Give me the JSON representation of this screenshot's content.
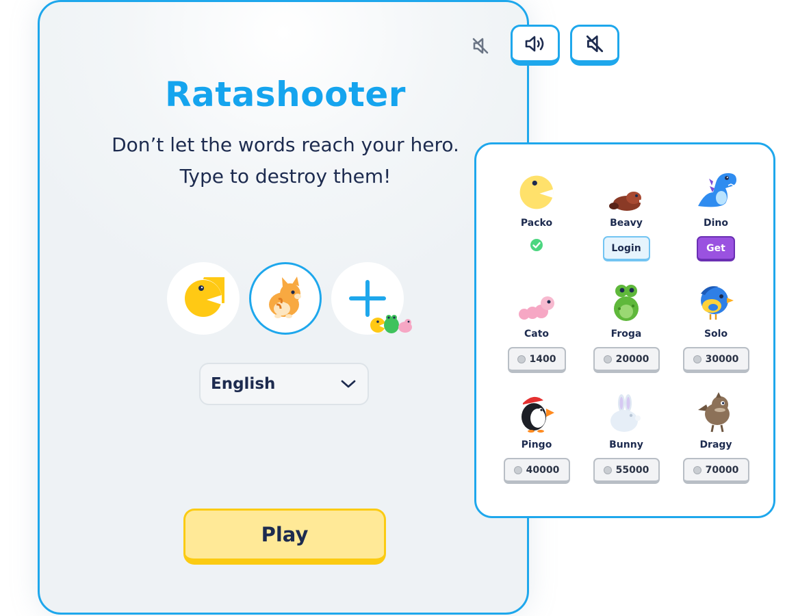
{
  "game": {
    "title": "Ratashooter",
    "subtitle_line1": "Don’t let the words reach your hero.",
    "subtitle_line2": "Type to destroy them!",
    "language": "English",
    "play_label": "Play"
  },
  "colors": {
    "accent": "#1ea7ec",
    "play": "#ffe997",
    "get": "#9a52e0",
    "owned": "#4cd680"
  },
  "heroes": [
    {
      "name": "packo",
      "icon": "packo-icon"
    },
    {
      "name": "cat",
      "icon": "orange-cat-icon",
      "selected": true
    },
    {
      "name": "more",
      "icon": "plus-icon"
    }
  ],
  "shop": {
    "characters": [
      {
        "name": "Packo",
        "status": "owned"
      },
      {
        "name": "Beavy",
        "action": "Login"
      },
      {
        "name": "Dino",
        "action": "Get"
      },
      {
        "name": "Cato",
        "price": "1400"
      },
      {
        "name": "Froga",
        "price": "20000"
      },
      {
        "name": "Solo",
        "price": "30000"
      },
      {
        "name": "Pingo",
        "price": "40000"
      },
      {
        "name": "Bunny",
        "price": "55000"
      },
      {
        "name": "Dragy",
        "price": "70000"
      }
    ]
  }
}
